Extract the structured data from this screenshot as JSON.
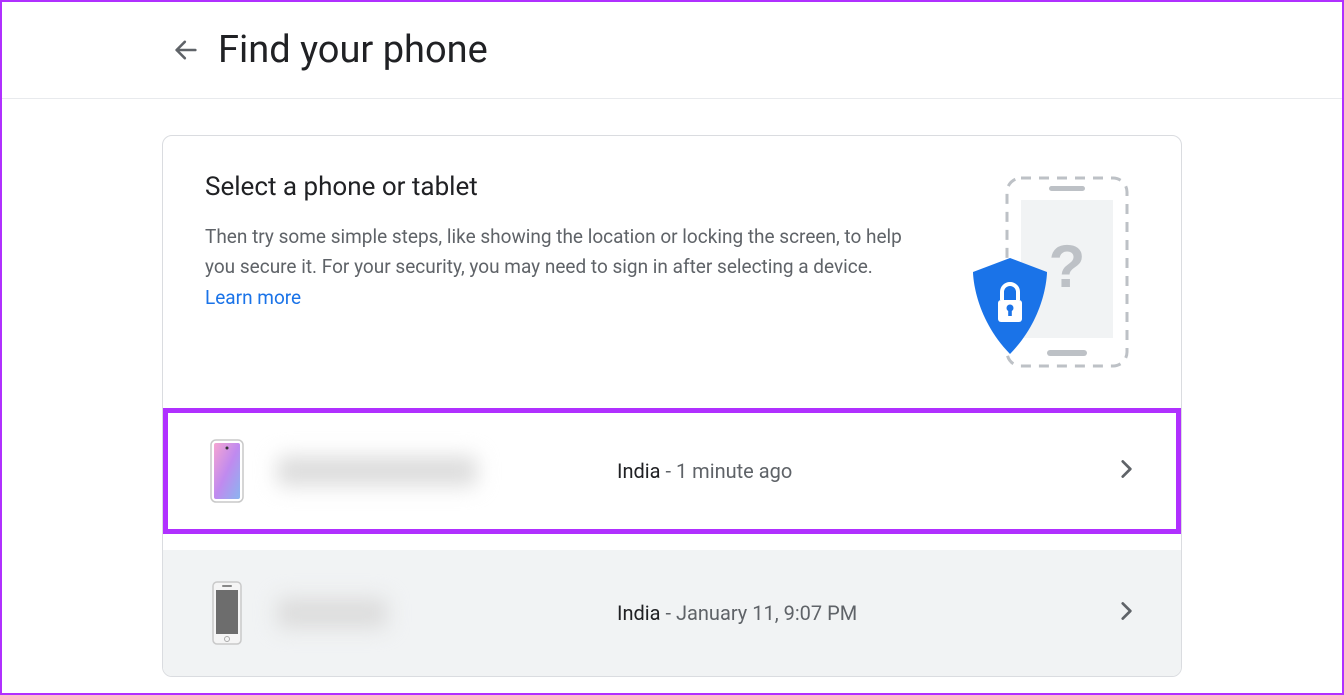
{
  "header": {
    "title": "Find your phone"
  },
  "intro": {
    "title": "Select a phone or tablet",
    "description": "Then try some simple steps, like showing the location or locking the screen, to help you secure it. For your security, you may need to sign in after selecting a device. ",
    "learn_more": "Learn more"
  },
  "devices": [
    {
      "location": "India",
      "time_separator": " - ",
      "time": "1 minute ago"
    },
    {
      "location": "India",
      "time_separator": " - ",
      "time": "January 11, 9:07 PM"
    }
  ]
}
